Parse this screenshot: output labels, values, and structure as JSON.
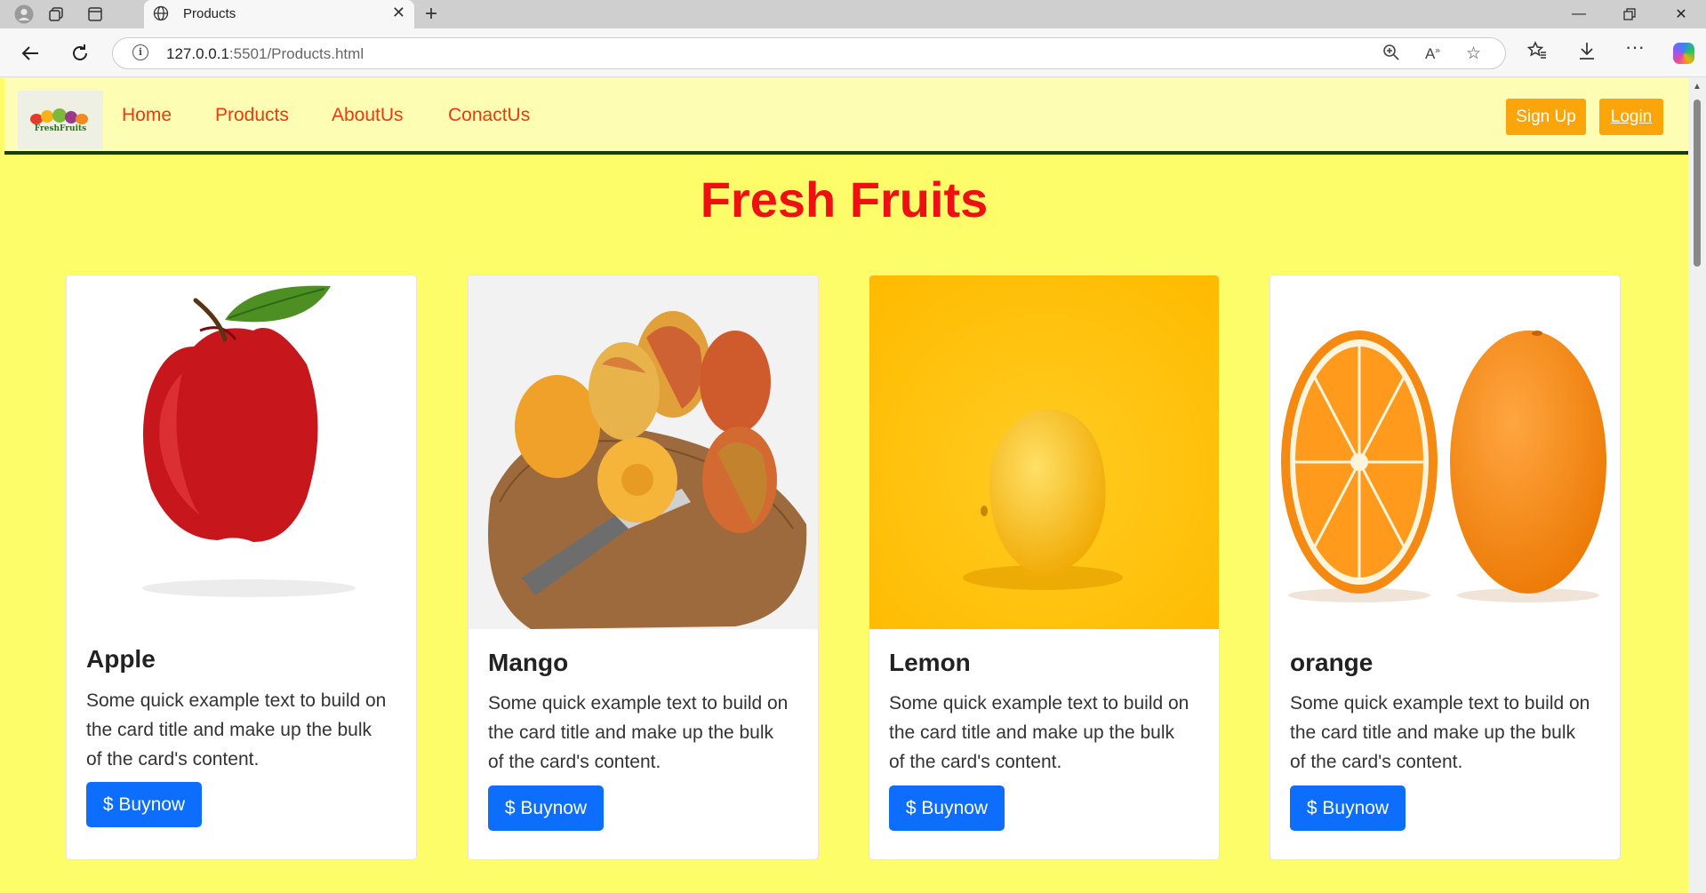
{
  "browser": {
    "tab_title": "Products",
    "url_host": "127.0.0.1",
    "url_rest": ":5501/Products.html"
  },
  "navbar": {
    "logo_text": "FreshFruits",
    "links": [
      "Home",
      "Products",
      "AboutUs",
      "ConactUs"
    ],
    "signup_label": "Sign Up",
    "login_label": "Login"
  },
  "page": {
    "title": "Fresh Fruits"
  },
  "cards": [
    {
      "title": "Apple",
      "text": "Some quick example text to build on the card title and make up the bulk of the card's content.",
      "button": "$ Buynow"
    },
    {
      "title": "Mango",
      "text": "Some quick example text to build on the card title and make up the bulk of the card's content.",
      "button": "$ Buynow"
    },
    {
      "title": "Lemon",
      "text": "Some quick example text to build on the card title and make up the bulk of the card's content.",
      "button": "$ Buynow"
    },
    {
      "title": "orange",
      "text": "Some quick example text to build on the card title and make up the bulk of the card's content.",
      "button": "$ Buynow"
    }
  ],
  "colors": {
    "page_bg": "#fdfd6a",
    "navbar_bg": "#fdfdb4",
    "nav_link": "#e83b10",
    "title": "#ee1111",
    "nav_button": "#fca50a",
    "buy_button": "#0d6efd"
  }
}
